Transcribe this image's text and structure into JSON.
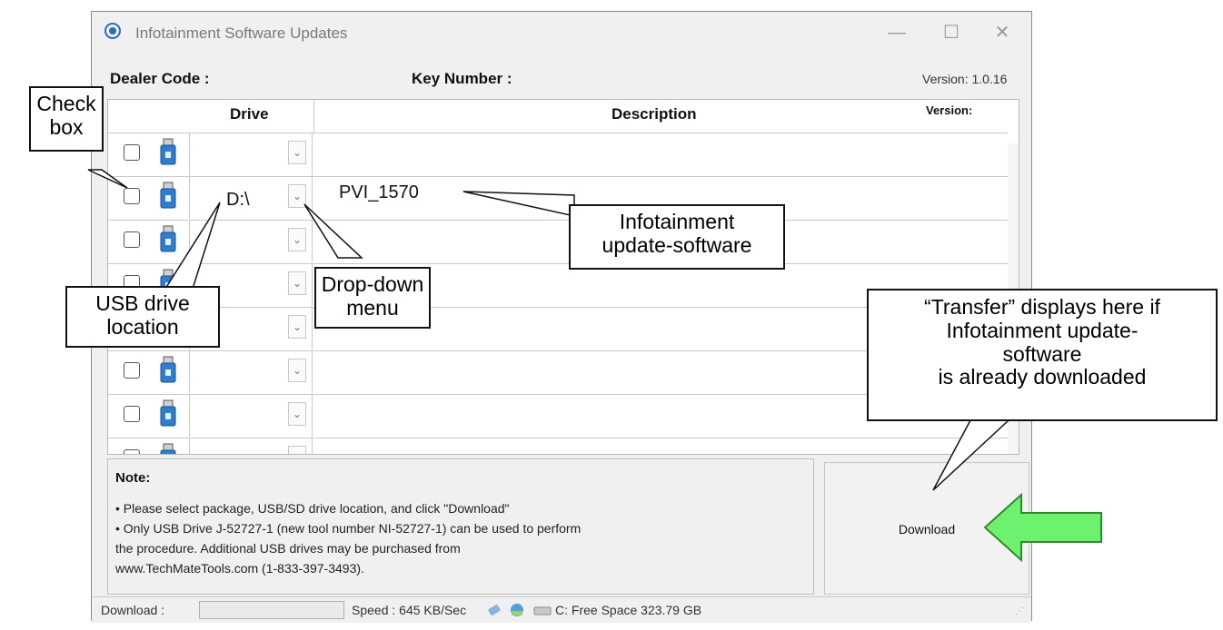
{
  "window": {
    "title": "Infotainment Software Updates",
    "controls": {
      "minimize": "—",
      "maximize": "☐",
      "close": "✕"
    }
  },
  "header": {
    "dealer_code_label": "Dealer Code :",
    "key_number_label": "Key Number :",
    "version_text": "Version: 1.0.16"
  },
  "grid": {
    "columns": {
      "drive": "Drive",
      "description": "Description",
      "version": "Version:"
    },
    "rows": [
      {
        "checked": false,
        "drive": "",
        "description": ""
      },
      {
        "checked": false,
        "drive": "D:\\",
        "description": "PVI_1570"
      },
      {
        "checked": false,
        "drive": "",
        "description": ""
      },
      {
        "checked": false,
        "drive": "",
        "description": ""
      },
      {
        "checked": false,
        "drive": "",
        "description": ""
      },
      {
        "checked": false,
        "drive": "",
        "description": ""
      },
      {
        "checked": false,
        "drive": "",
        "description": ""
      },
      {
        "checked": false,
        "drive": "",
        "description": ""
      }
    ],
    "dropdown_glyph": "⌄"
  },
  "note": {
    "title": "Note:",
    "lines": [
      "• Please select package, USB/SD drive location, and click \"Download\"",
      "• Only USB Drive J-52727-1 (new tool number NI-52727-1) can be used to perform",
      "  the procedure. Additional USB drives may be purchased from",
      "  www.TechMateTools.com (1-833-397-3493)."
    ]
  },
  "download_button": "Download",
  "status_bar": {
    "download_label": "Download :",
    "speed_text": "Speed : 645 KB/Sec",
    "free_space_text": "C: Free Space 323.79 GB"
  },
  "callouts": {
    "check_box": [
      "Check",
      "box"
    ],
    "usb_drive": [
      "USB drive",
      "location"
    ],
    "dropdown": [
      "Drop-down",
      "menu"
    ],
    "software": [
      "Infotainment",
      "update-software"
    ],
    "transfer": [
      "“Transfer” displays here if",
      "Infotainment update-",
      "software",
      "is already downloaded"
    ]
  },
  "colors": {
    "arrow_fill": "#6cf26c",
    "arrow_stroke": "#2d8a2d",
    "usb_blue": "#2a7fd4"
  }
}
